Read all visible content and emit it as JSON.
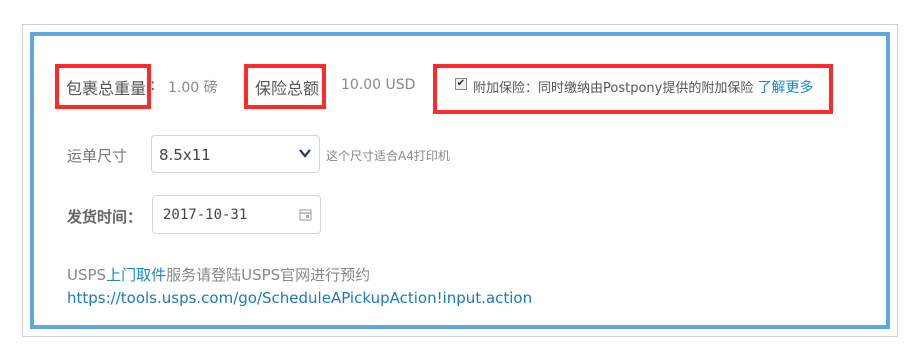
{
  "summary": {
    "weight_label": "包裹总重量",
    "weight_colon": ":",
    "weight_value": "1.00 磅",
    "insurance_label": "保险总额",
    "insurance_colon": ":",
    "insurance_value": "10.00 USD"
  },
  "addon": {
    "checked": true,
    "prefix": "附加保险：同时缴纳由Postpony提供的附加保险",
    "learn_more": "了解更多"
  },
  "label_size": {
    "label": "运单尺寸",
    "selected": "8.5x11",
    "hint": "这个尺寸适合A4打印机"
  },
  "ship_date": {
    "label": "发货时间：",
    "value": "2017-10-31"
  },
  "pickup": {
    "pre": "USPS",
    "link": "上门取件",
    "post": "服务请登陆USPS官网进行预约",
    "url": "https://tools.usps.com/go/ScheduleAPickupAction!input.action"
  },
  "colors": {
    "frame_blue": "#5ca7e0",
    "highlight_red": "#ff2a2a",
    "link_blue": "#1a88c9"
  }
}
